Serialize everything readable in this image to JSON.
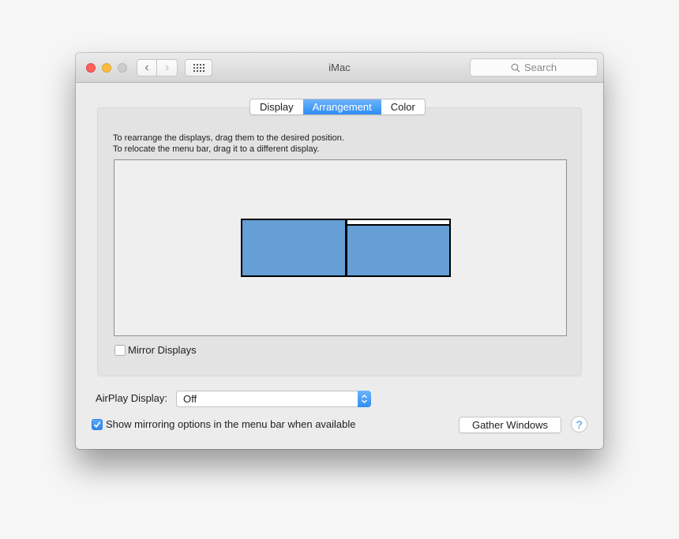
{
  "window": {
    "title": "iMac",
    "nav": {
      "back_glyph": "‹",
      "forward_glyph": "›"
    },
    "search": {
      "placeholder": "Search",
      "icon": "search-icon"
    }
  },
  "tabs": [
    {
      "label": "Display",
      "active": false
    },
    {
      "label": "Arrangement",
      "active": true
    },
    {
      "label": "Color",
      "active": false
    }
  ],
  "arrangement": {
    "instructions": [
      "To rearrange the displays, drag them to the desired position.",
      "To relocate the menu bar, drag it to a different display."
    ],
    "displays": [
      {
        "id": "display-1",
        "has_menu_bar": false
      },
      {
        "id": "display-2",
        "has_menu_bar": true
      }
    ],
    "display_color": "#659fd6",
    "mirror_displays": {
      "label": "Mirror Displays",
      "checked": false
    }
  },
  "airplay": {
    "label": "AirPlay Display:",
    "selected": "Off"
  },
  "show_mirroring": {
    "label": "Show mirroring options in the menu bar when available",
    "checked": true
  },
  "buttons": {
    "gather_windows": "Gather Windows",
    "help": "?"
  },
  "accent_color": "#2f8df5"
}
